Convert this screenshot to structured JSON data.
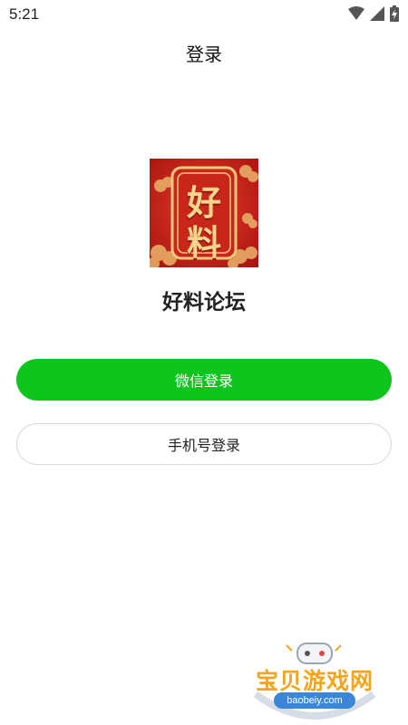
{
  "status_bar": {
    "time": "5:21",
    "icons": [
      "wifi-icon",
      "signal-icon",
      "battery-charging-icon"
    ]
  },
  "header": {
    "title": "登录"
  },
  "app": {
    "logo": {
      "char_top": "好",
      "char_bottom": "料"
    },
    "name": "好料论坛"
  },
  "buttons": {
    "wechat_login": "微信登录",
    "phone_login": "手机号登录"
  },
  "watermark": {
    "name": "宝贝游戏网",
    "url": "baobeiy.com"
  },
  "colors": {
    "wechat_green": "#10c41e",
    "logo_red": "#c8261b",
    "logo_gold": "#f7d58a",
    "watermark_orange": "#f5a51c",
    "watermark_blue": "#3b86d9"
  }
}
